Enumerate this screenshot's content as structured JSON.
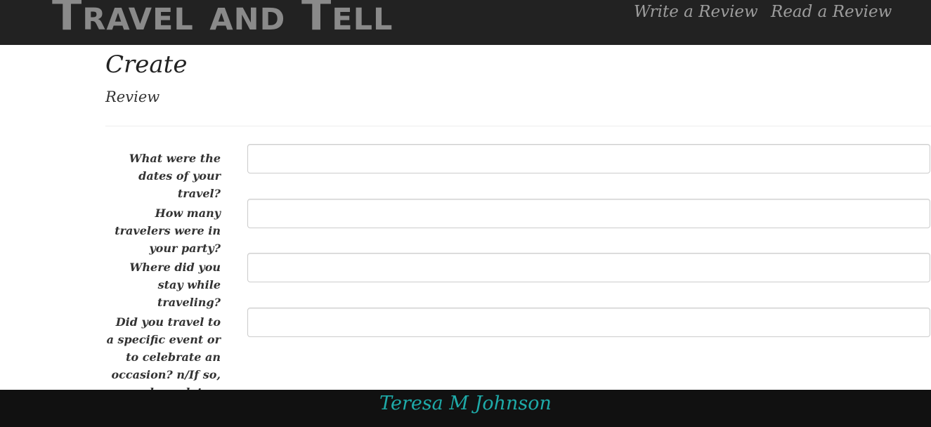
{
  "navbar": {
    "brand": "Travel and Tell",
    "links": [
      {
        "label": "Write a Review"
      },
      {
        "label": "Read a Review"
      }
    ]
  },
  "page": {
    "title": "Create",
    "subtitle": "Review"
  },
  "form": {
    "fields": [
      {
        "label": "What were the dates of your travel?",
        "value": ""
      },
      {
        "label": "How many travelers were in your party?",
        "value": ""
      },
      {
        "label": "Where did you stay while traveling?",
        "value": ""
      },
      {
        "label": "Did you travel to a specific event or to celebrate an occasion? n/If so, please let us know",
        "value": ""
      }
    ]
  },
  "footer": {
    "name": "Teresa M Johnson"
  },
  "colors": {
    "navbar_bg": "#222222",
    "footer_bg": "#111111",
    "footer_text": "#1eaaa8"
  }
}
